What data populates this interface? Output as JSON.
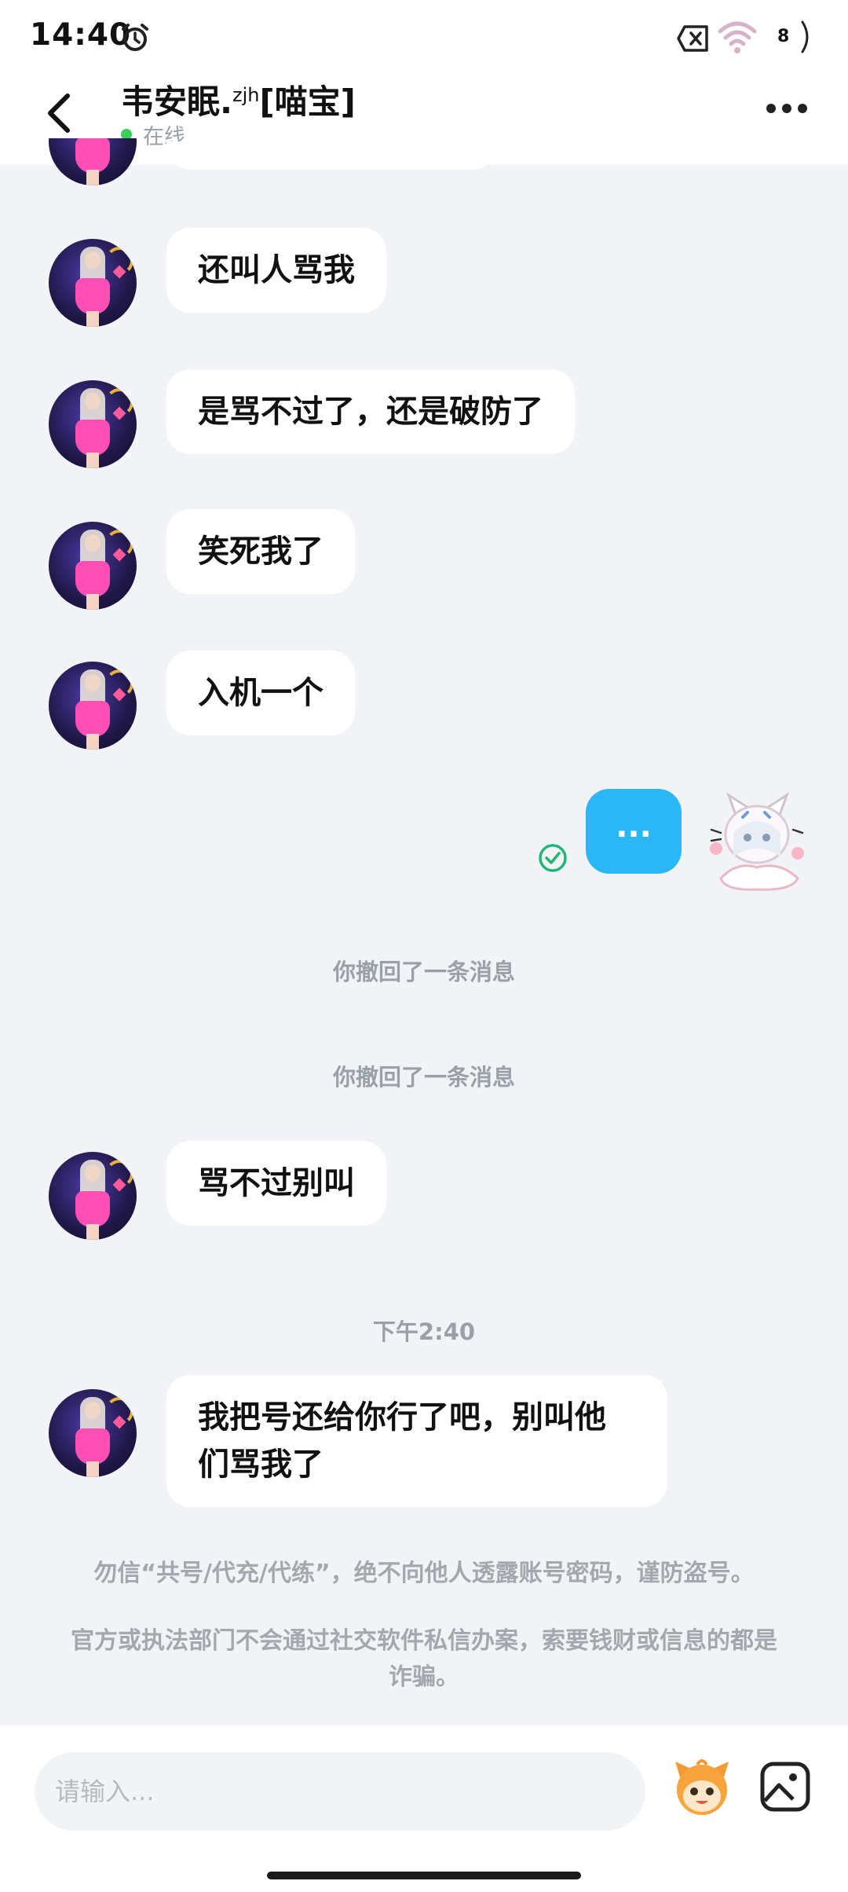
{
  "status_bar": {
    "time": "14:40",
    "battery": "8",
    "icons": [
      "alarm-icon",
      "sim-icon",
      "wifi-icon",
      "battery-icon"
    ]
  },
  "header": {
    "name_main": "韦安眠.",
    "name_sup": "zjh",
    "name_tag": "[喵宝]",
    "status": "在线",
    "status_color": "#3ccf5a"
  },
  "messages": [
    {
      "from": "other",
      "text": "还叫人骂我"
    },
    {
      "from": "other",
      "text": "是骂不过了，还是破防了"
    },
    {
      "from": "other",
      "text": "笑死我了"
    },
    {
      "from": "other",
      "text": "入机一个"
    },
    {
      "from": "self",
      "text": "..."
    },
    {
      "from": "system",
      "text": "你撤回了一条消息"
    },
    {
      "from": "system",
      "text": "你撤回了一条消息"
    },
    {
      "from": "other",
      "text": "骂不过别叫"
    },
    {
      "from": "system",
      "text": "下午2:40"
    },
    {
      "from": "other",
      "text": "我把号还给你行了吧，别叫他们骂我了"
    }
  ],
  "notices": [
    "勿信“共号/代充/代练”，绝不向他人透露账号密码，谨防盗号。",
    "官方或执法部门不会通过社交软件私信办案，索要钱财或信息的都是诈骗。"
  ],
  "input": {
    "placeholder": "请输入..."
  },
  "colors": {
    "self_bubble": "#2bb7f5",
    "background": "#f2f3f7"
  }
}
